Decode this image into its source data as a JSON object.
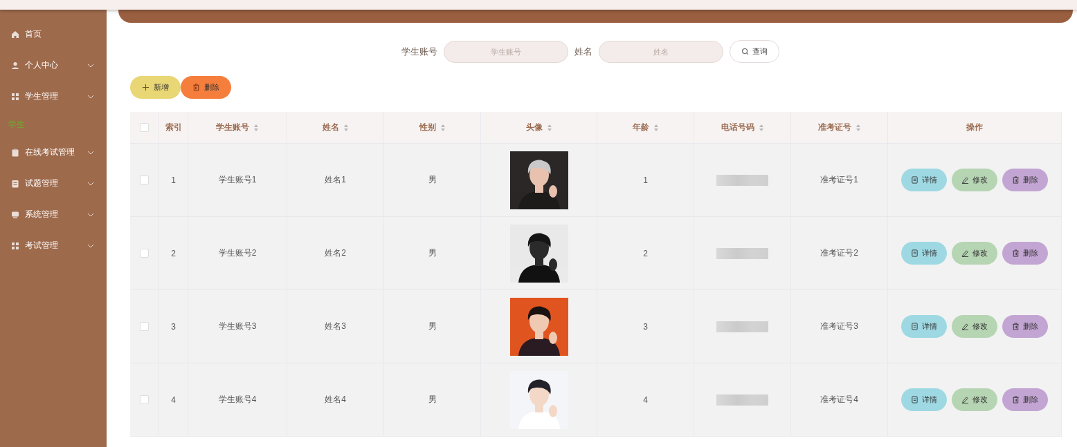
{
  "sidebar": {
    "items": [
      {
        "label": "首页",
        "has_submenu": false
      },
      {
        "label": "个人中心",
        "has_submenu": true
      },
      {
        "label": "学生管理",
        "has_submenu": true,
        "children": [
          {
            "label": "学生",
            "selected": true
          }
        ]
      },
      {
        "label": "在线考试管理",
        "has_submenu": true
      },
      {
        "label": "试题管理",
        "has_submenu": true
      },
      {
        "label": "系统管理",
        "has_submenu": true
      },
      {
        "label": "考试管理",
        "has_submenu": true
      }
    ]
  },
  "search": {
    "fields": [
      {
        "label": "学生账号",
        "placeholder": "学生账号"
      },
      {
        "label": "姓名",
        "placeholder": "姓名"
      }
    ],
    "button": "查询"
  },
  "toolbar": [
    {
      "kind": "add",
      "label": "新增"
    },
    {
      "kind": "delete",
      "label": "删除"
    }
  ],
  "table": {
    "select_all_checked": false,
    "columns": [
      {
        "label": "索引",
        "sortable": false
      },
      {
        "label": "学生账号",
        "sortable": true
      },
      {
        "label": "姓名",
        "sortable": true
      },
      {
        "label": "性别",
        "sortable": true
      },
      {
        "label": "头像",
        "sortable": true
      },
      {
        "label": "年龄",
        "sortable": true
      },
      {
        "label": "电话号码",
        "sortable": true
      },
      {
        "label": "准考证号",
        "sortable": true
      },
      {
        "label": "操作",
        "sortable": false
      }
    ],
    "rows": [
      {
        "checked": false,
        "index": "1",
        "account": "学生账号1",
        "name": "姓名1",
        "gender": "男",
        "avatar": {
          "kind": "picture"
        },
        "age": "1",
        "ticket": "准考证号1",
        "actions": [
          {
            "kind": "detail",
            "label": "详情"
          },
          {
            "kind": "edit",
            "label": "修改"
          },
          {
            "kind": "delete",
            "label": "删除"
          }
        ]
      },
      {
        "checked": false,
        "index": "2",
        "account": "学生账号2",
        "name": "姓名2",
        "gender": "男",
        "avatar": {
          "kind": "picture"
        },
        "age": "2",
        "ticket": "准考证号2",
        "actions": [
          {
            "kind": "detail",
            "label": "详情"
          },
          {
            "kind": "edit",
            "label": "修改"
          },
          {
            "kind": "delete",
            "label": "删除"
          }
        ]
      },
      {
        "checked": false,
        "index": "3",
        "account": "学生账号3",
        "name": "姓名3",
        "gender": "男",
        "avatar": {
          "kind": "picture"
        },
        "age": "3",
        "ticket": "准考证号3",
        "actions": [
          {
            "kind": "detail",
            "label": "详情"
          },
          {
            "kind": "edit",
            "label": "修改"
          },
          {
            "kind": "delete",
            "label": "删除"
          }
        ]
      },
      {
        "checked": false,
        "index": "4",
        "account": "学生账号4",
        "name": "姓名4",
        "gender": "男",
        "avatar": {
          "kind": "picture"
        },
        "age": "4",
        "ticket": "准考证号4",
        "actions": [
          {
            "kind": "detail",
            "label": "详情"
          },
          {
            "kind": "edit",
            "label": "修改"
          },
          {
            "kind": "delete",
            "label": "删除"
          }
        ]
      }
    ]
  }
}
